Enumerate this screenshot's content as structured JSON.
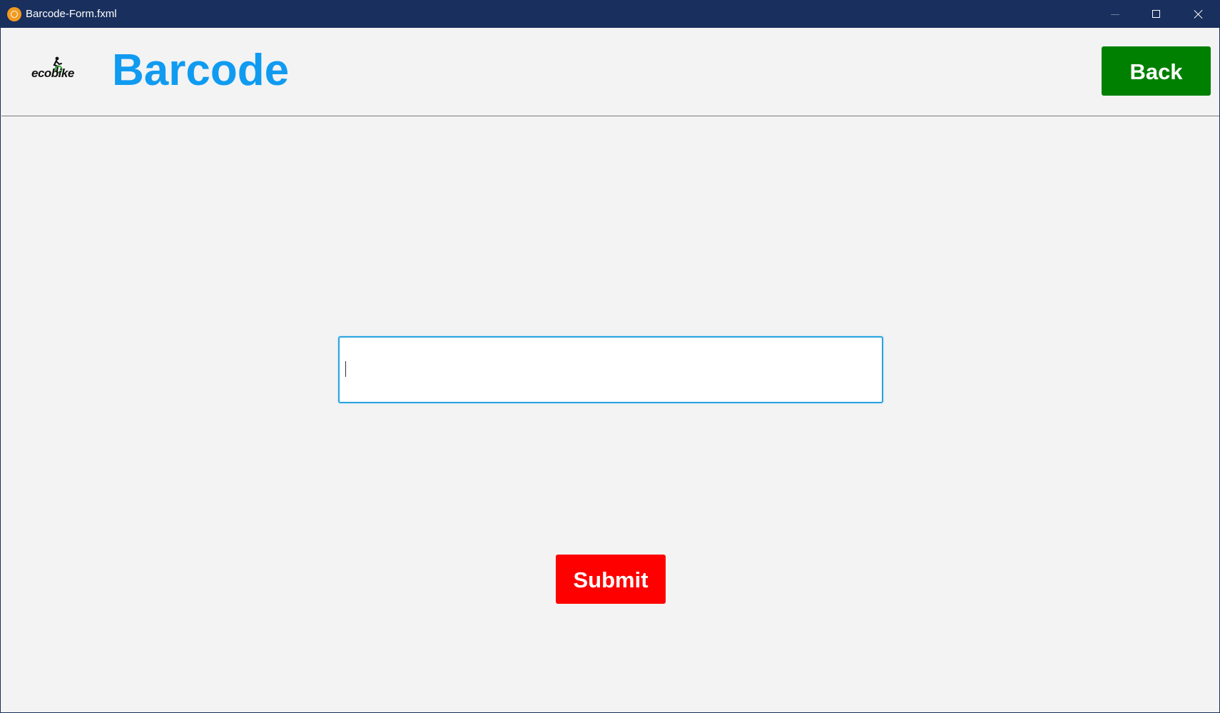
{
  "window": {
    "title": "Barcode-Form.fxml",
    "app_icon": "java-app-icon",
    "controls": [
      "minimize-icon",
      "maximize-icon",
      "close-icon"
    ]
  },
  "header": {
    "logo_text": "ecobike",
    "title": "Barcode",
    "title_color": "#109bf1",
    "back_label": "Back",
    "back_color": "#008000"
  },
  "form": {
    "barcode_value": "",
    "barcode_placeholder": "",
    "submit_label": "Submit",
    "submit_color": "#ff0000"
  }
}
